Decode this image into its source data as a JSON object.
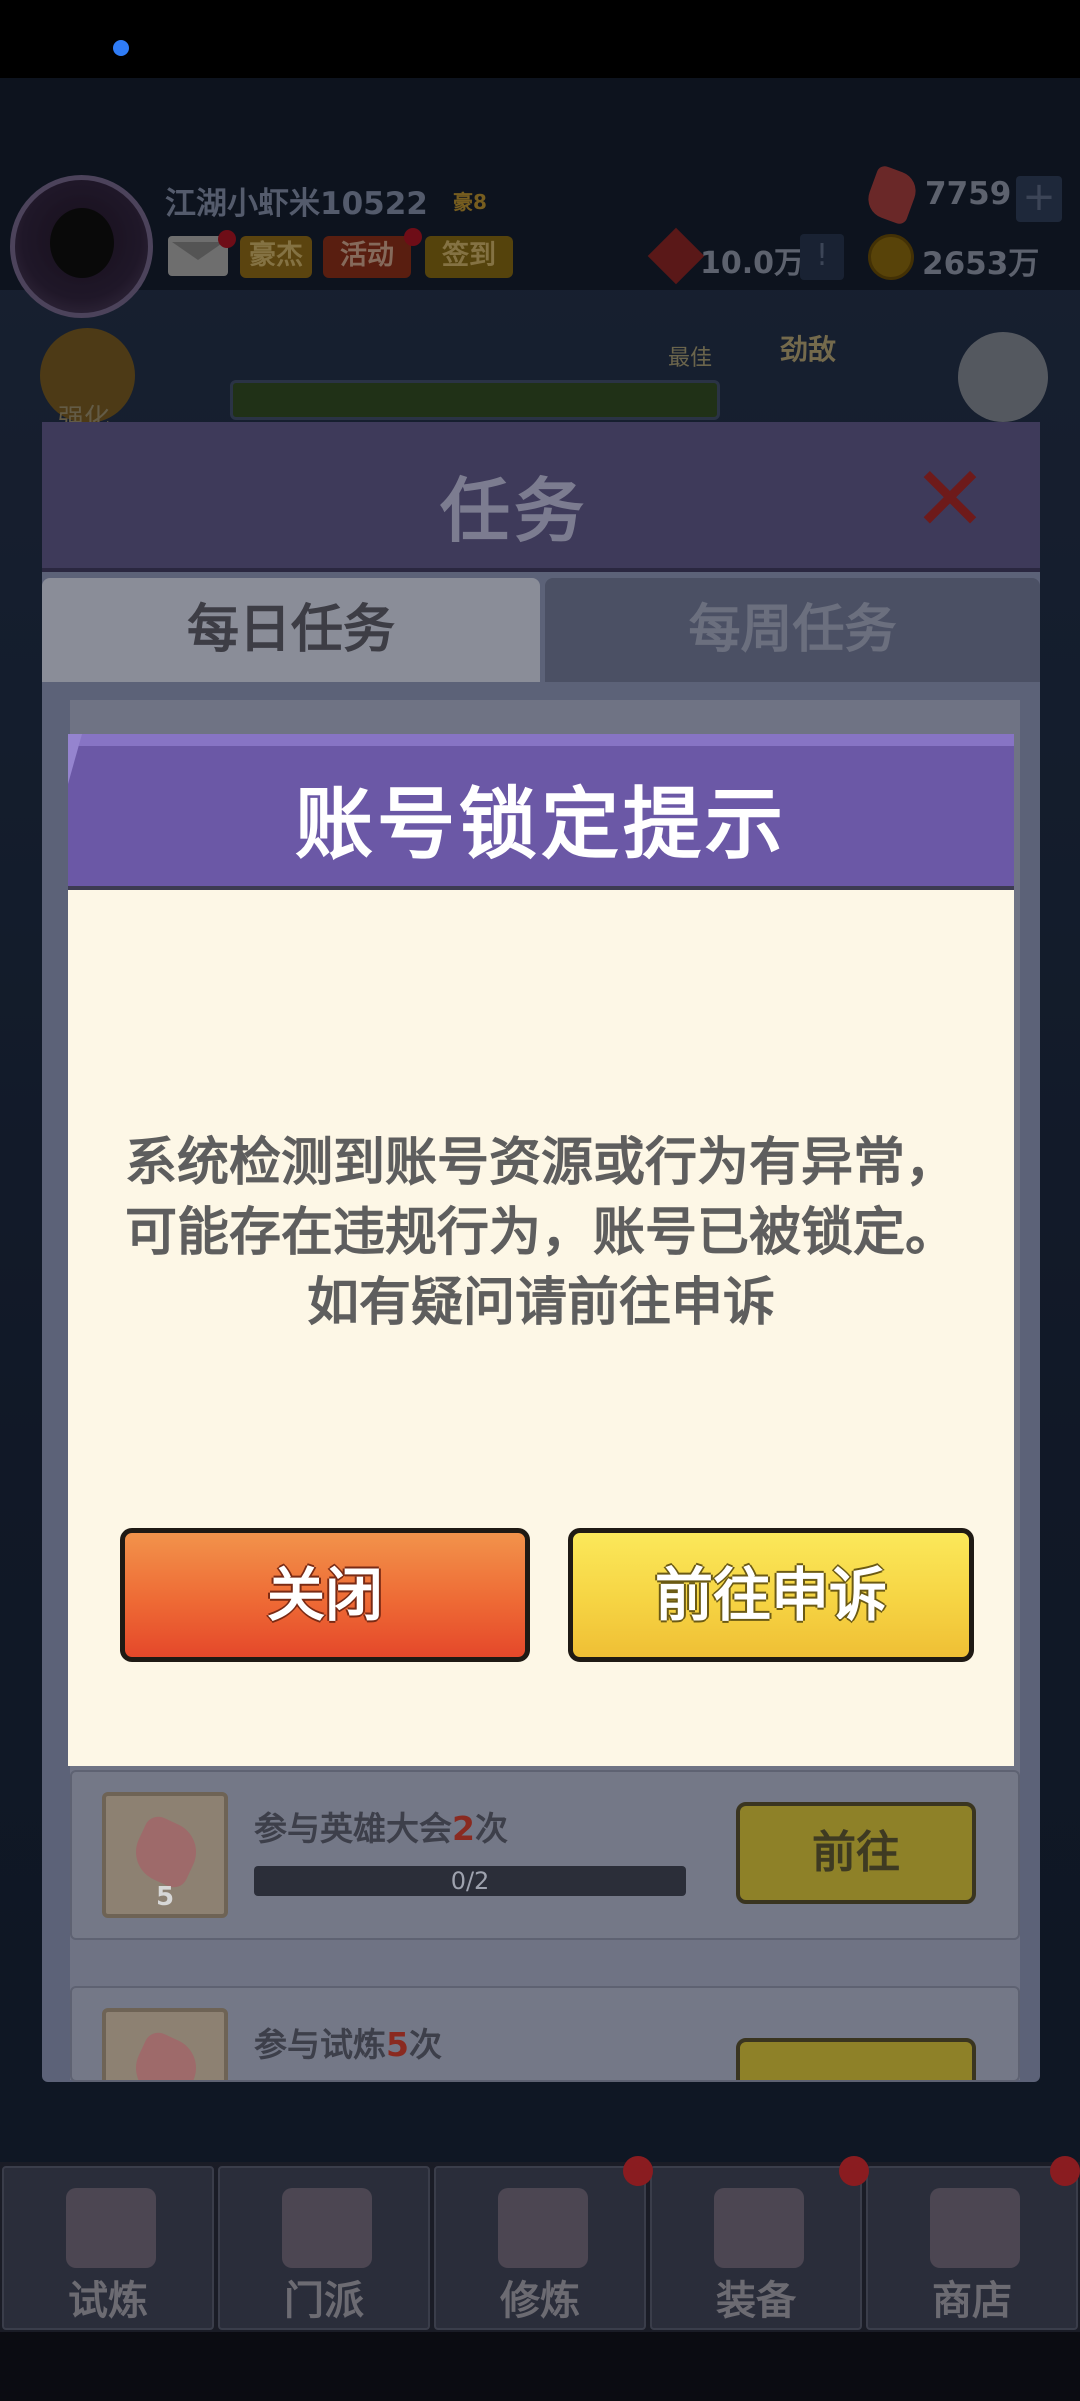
{
  "player": {
    "name": "江湖小虾米10522",
    "vip": "豪8",
    "gems": "7759",
    "tokens": "10.0万",
    "coins": "2653万"
  },
  "header_buttons": {
    "hero": "豪杰",
    "activity": "活动",
    "signin": "签到",
    "add": "+",
    "info": "!"
  },
  "progress": {
    "strengthen": "强化",
    "best": "最佳",
    "rival": "劲敌"
  },
  "task_panel": {
    "title": "任务",
    "close": "✕",
    "tabs": [
      "每日任务",
      "每周任务"
    ],
    "tasks": [
      {
        "reward_qty": "5",
        "name_prefix": "参与英雄大会",
        "name_count": "2",
        "name_suffix": "次",
        "progress": "0/2",
        "action": "前往"
      },
      {
        "reward_qty": "",
        "name_prefix": "参与试炼",
        "name_count": "5",
        "name_suffix": "次",
        "progress": "",
        "action": ""
      }
    ]
  },
  "modal": {
    "title": "账号锁定提示",
    "message": "系统检测到账号资源或行为有异常，可能存在违规行为，账号已被锁定。如有疑问请前往申诉",
    "close_button": "关闭",
    "appeal_button": "前往申诉"
  },
  "bottom_nav": [
    "试炼",
    "门派",
    "修炼",
    "装备",
    "商店"
  ]
}
